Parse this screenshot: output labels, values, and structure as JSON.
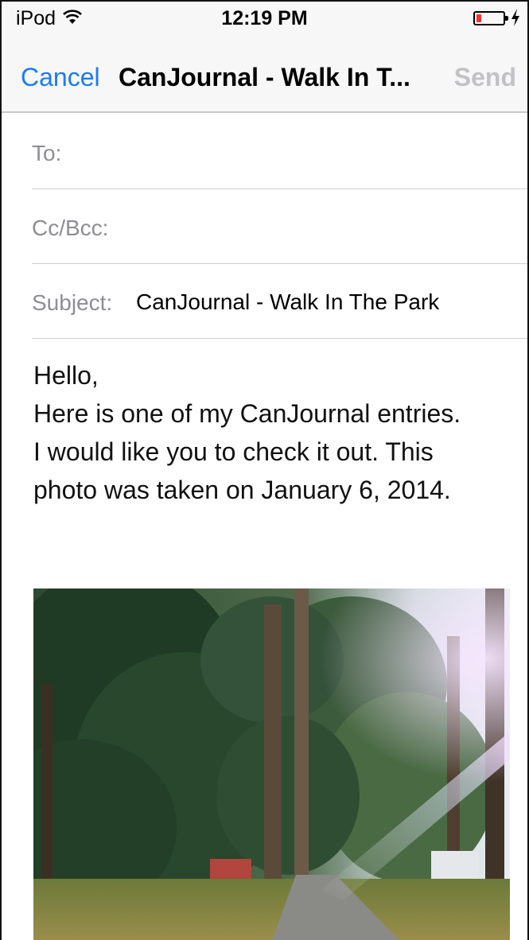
{
  "status_bar": {
    "device": "iPod",
    "time": "12:19 PM",
    "battery_level": 0.18,
    "battery_color": "#ff2d2d"
  },
  "nav": {
    "cancel_label": "Cancel",
    "title": "CanJournal - Walk In T...",
    "send_label": "Send",
    "accent_color": "#1a7cf5"
  },
  "fields": {
    "to_label": "To:",
    "to_value": "",
    "cc_label": "Cc/Bcc:",
    "cc_value": "",
    "subject_label": "Subject:",
    "subject_value": "CanJournal - Walk In The Park"
  },
  "body": {
    "lines": [
      "Hello,",
      "Here is one of my CanJournal entries.",
      "I would like you to check it out. This",
      "photo was taken on January 6, 2014."
    ]
  },
  "attachment": {
    "icon": "photo-image"
  }
}
